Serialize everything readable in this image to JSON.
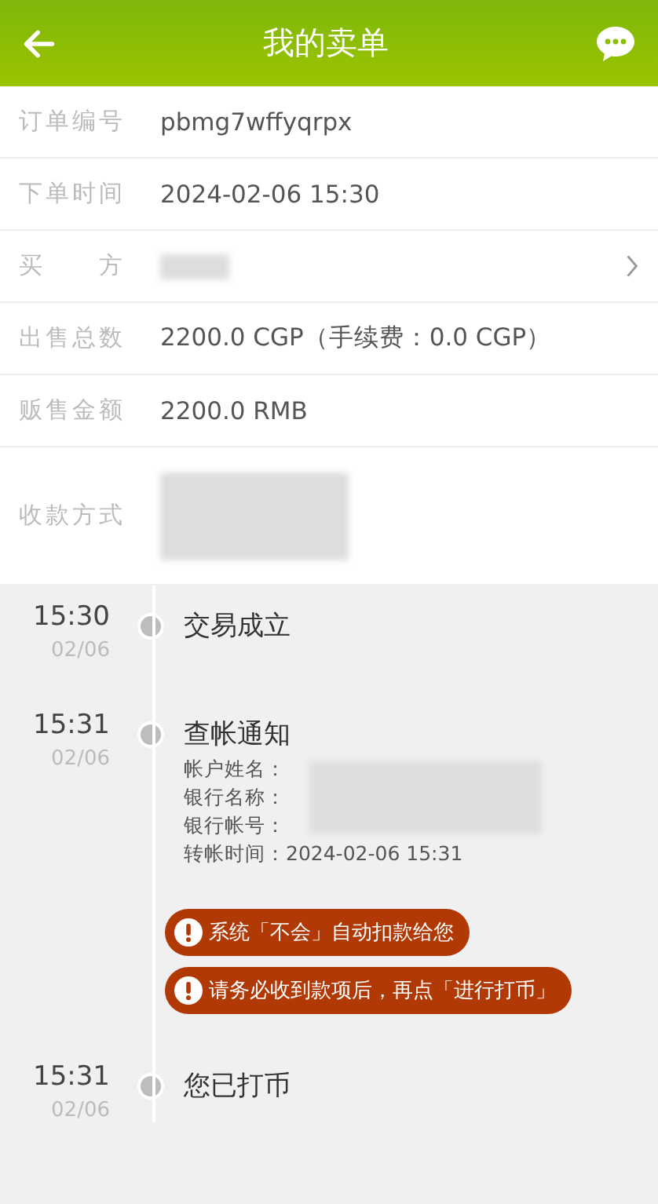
{
  "header": {
    "title": "我的卖单"
  },
  "fields": [
    {
      "label": "订单编号",
      "value": "pbmg7wffyqrpx",
      "kind": "text"
    },
    {
      "label": "下单时间",
      "value": "2024-02-06 15:30",
      "kind": "text"
    },
    {
      "label": "买 方",
      "kind": "link"
    },
    {
      "label": "出售总数",
      "value": "2200.0 CGP（手续费：0.0 CGP）",
      "kind": "text"
    },
    {
      "label": "贩售金额",
      "value": "2200.0 RMB",
      "kind": "text"
    },
    {
      "label": "收款方式",
      "kind": "tall"
    }
  ],
  "timeline": [
    {
      "time": "15:30",
      "date": "02/06",
      "title": "交易成立"
    },
    {
      "time": "15:31",
      "date": "02/06",
      "title": "查帐通知",
      "details": [
        "帐户姓名：",
        "银行名称：",
        "银行帐号：",
        "转帐时间：2024-02-06 15:31"
      ],
      "alerts": [
        "系统「不会」自动扣款给您",
        "请务必收到款项后，再点「进行打币」"
      ]
    },
    {
      "time": "15:31",
      "date": "02/06",
      "title": "您已打币"
    }
  ]
}
